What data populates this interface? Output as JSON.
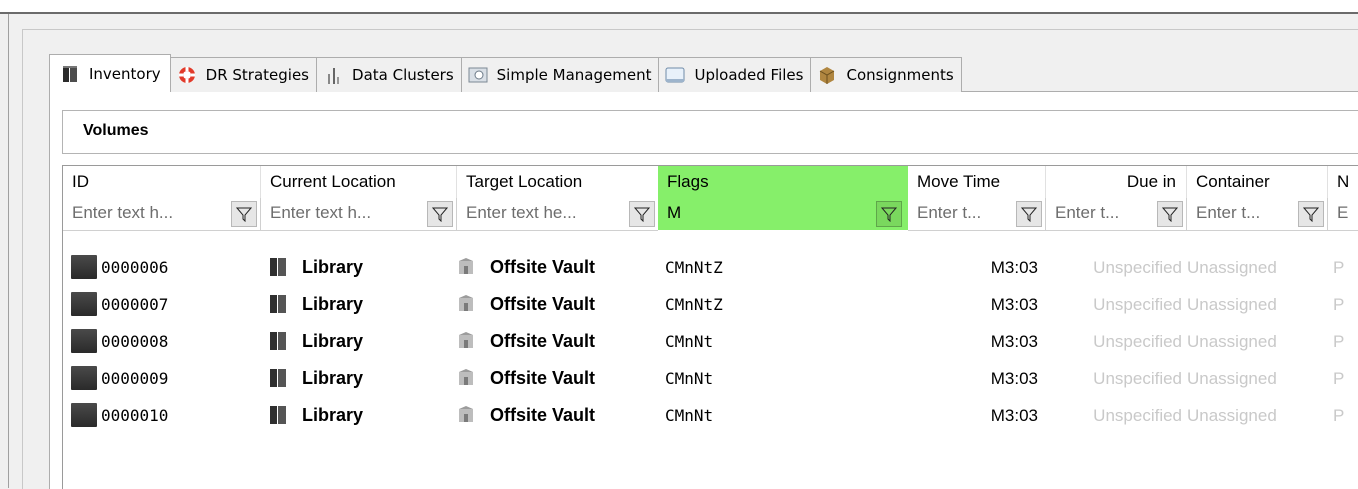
{
  "tabs": [
    {
      "label": "Inventory",
      "icon": "inventory-icon",
      "active": true
    },
    {
      "label": "DR Strategies",
      "icon": "lifebuoy-icon"
    },
    {
      "label": "Data Clusters",
      "icon": "cluster-icon"
    },
    {
      "label": "Simple Management",
      "icon": "management-icon"
    },
    {
      "label": "Uploaded Files",
      "icon": "window-icon"
    },
    {
      "label": "Consignments",
      "icon": "package-icon"
    }
  ],
  "section": {
    "title": "Volumes"
  },
  "columns": [
    {
      "key": "id",
      "label": "ID",
      "placeholder": "Enter text h..."
    },
    {
      "key": "current_location",
      "label": "Current Location",
      "placeholder": "Enter text h..."
    },
    {
      "key": "target_location",
      "label": "Target Location",
      "placeholder": "Enter text he..."
    },
    {
      "key": "flags",
      "label": "Flags",
      "filter_value": "M"
    },
    {
      "key": "move_time",
      "label": "Move Time",
      "placeholder": "Enter t..."
    },
    {
      "key": "due_in",
      "label": "Due in",
      "placeholder": "Enter t..."
    },
    {
      "key": "container",
      "label": "Container",
      "placeholder": "Enter t..."
    },
    {
      "key": "next",
      "label": "N",
      "placeholder": "E"
    }
  ],
  "rows": [
    {
      "id": "0000006",
      "current_location": "Library",
      "target_location": "Offsite Vault",
      "flags": "CMnNtZ",
      "move_time": "M3:03",
      "due_in": "Unspecified",
      "container": "Unassigned",
      "next": "P"
    },
    {
      "id": "0000007",
      "current_location": "Library",
      "target_location": "Offsite Vault",
      "flags": "CMnNtZ",
      "move_time": "M3:03",
      "due_in": "Unspecified",
      "container": "Unassigned",
      "next": "P"
    },
    {
      "id": "0000008",
      "current_location": "Library",
      "target_location": "Offsite Vault",
      "flags": "CMnNt",
      "move_time": "M3:03",
      "due_in": "Unspecified",
      "container": "Unassigned",
      "next": "P"
    },
    {
      "id": "0000009",
      "current_location": "Library",
      "target_location": "Offsite Vault",
      "flags": "CMnNt",
      "move_time": "M3:03",
      "due_in": "Unspecified",
      "container": "Unassigned",
      "next": "P"
    },
    {
      "id": "0000010",
      "current_location": "Library",
      "target_location": "Offsite Vault",
      "flags": "CMnNt",
      "move_time": "M3:03",
      "due_in": "Unspecified",
      "container": "Unassigned",
      "next": "P"
    }
  ],
  "colors": {
    "flags_header_bg": "#86ef6a",
    "muted_text": "#c9c9c9"
  }
}
